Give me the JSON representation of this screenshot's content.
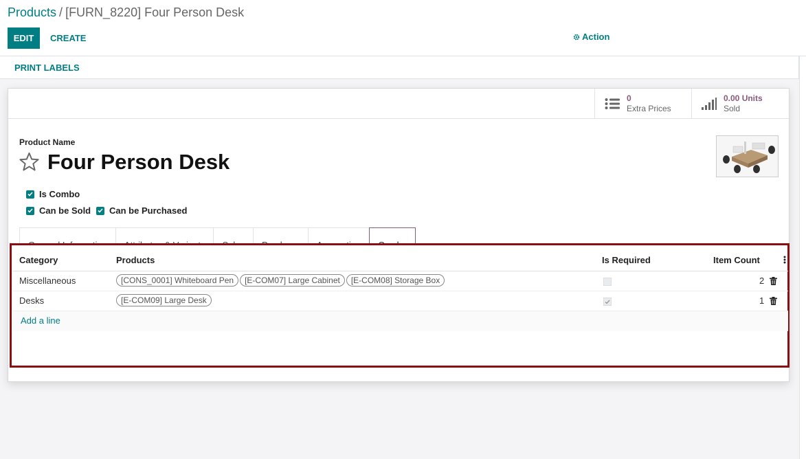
{
  "breadcrumb": {
    "parent": "Products",
    "separator": "/",
    "current": "[FURN_8220] Four Person Desk"
  },
  "toolbar": {
    "edit_label": "EDIT",
    "create_label": "CREATE",
    "action_label": "Action",
    "action_icon": "gear-icon"
  },
  "statusbar": {
    "print_labels": "PRINT LABELS"
  },
  "stat_buttons": [
    {
      "value": "0",
      "label": "Extra Prices",
      "icon": "list-icon"
    },
    {
      "value": "0.00 Units",
      "label": "Sold",
      "icon": "signal-bars-icon"
    }
  ],
  "product": {
    "name_label": "Product Name",
    "name": "Four Person Desk",
    "image": "office-desk-photo"
  },
  "checkboxes": {
    "is_combo": "Is Combo",
    "can_be_sold": "Can be Sold",
    "can_be_purchased": "Can be Purchased"
  },
  "tabs": [
    {
      "label": "General Information",
      "active": false
    },
    {
      "label": "Attributes & Variants",
      "active": false
    },
    {
      "label": "Sales",
      "active": false
    },
    {
      "label": "Purchase",
      "active": false
    },
    {
      "label": "Accounting",
      "active": false
    },
    {
      "label": "Combo",
      "active": true
    }
  ],
  "combo_table": {
    "headers": {
      "category": "Category",
      "products": "Products",
      "is_required": "Is Required",
      "item_count": "Item Count"
    },
    "rows": [
      {
        "category": "Miscellaneous",
        "products": [
          "[CONS_0001] Whiteboard Pen",
          "[E-COM07] Large Cabinet",
          "[E-COM08] Storage Box"
        ],
        "is_required": false,
        "item_count": "2"
      },
      {
        "category": "Desks",
        "products": [
          "[E-COM09] Large Desk"
        ],
        "is_required": true,
        "item_count": "1"
      }
    ],
    "add_line": "Add a line"
  },
  "colors": {
    "primary": "#017e84",
    "accent": "#875a7b",
    "highlight_border": "#8b0e13"
  }
}
